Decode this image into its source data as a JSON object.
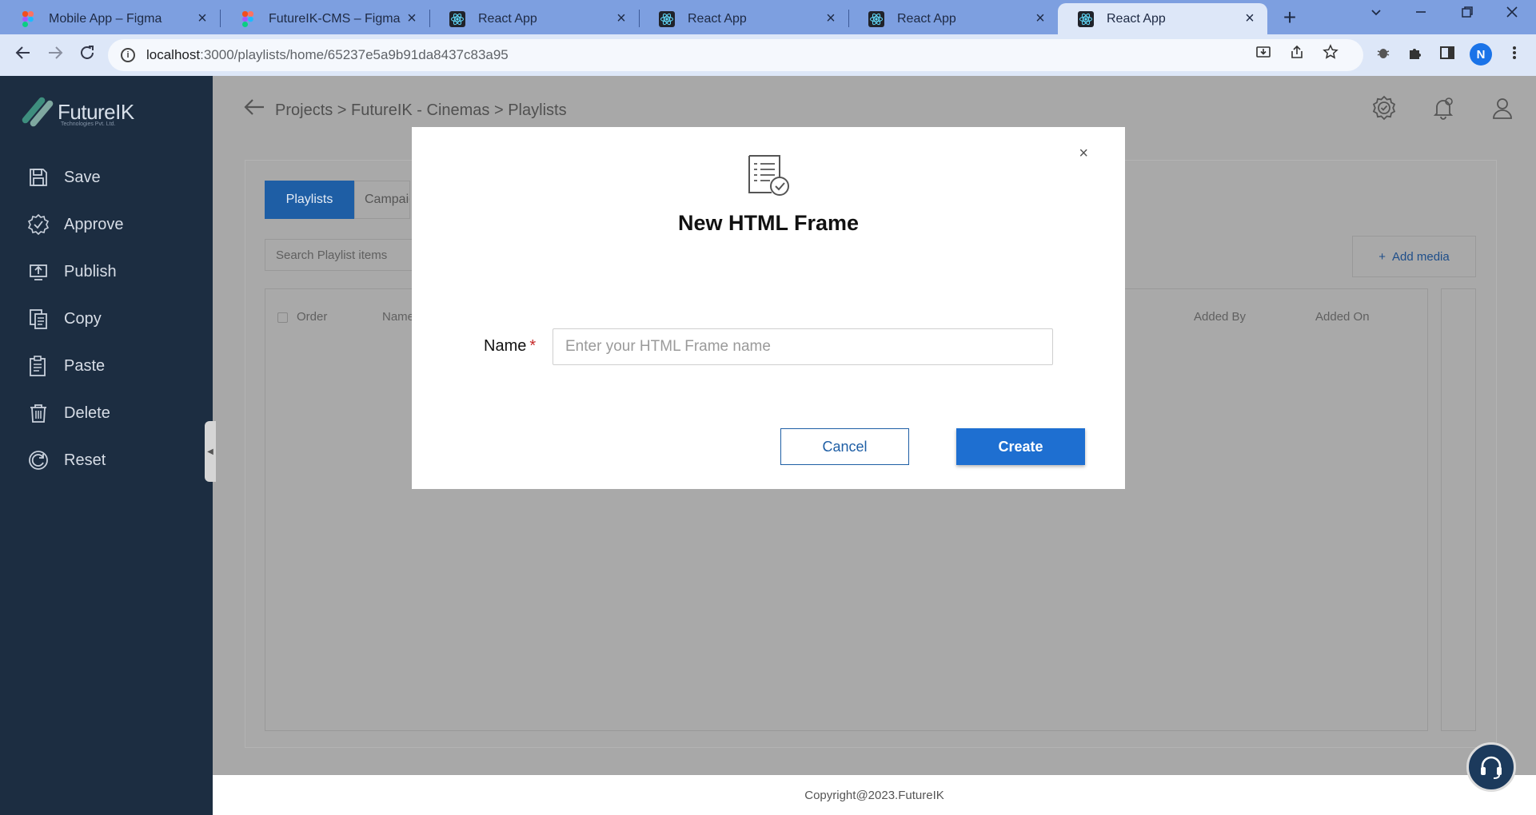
{
  "browser": {
    "tabs": [
      {
        "title": "Mobile App – Figma",
        "icon": "figma-icon"
      },
      {
        "title": "FutureIK-CMS – Figma",
        "icon": "figma-icon"
      },
      {
        "title": "React App",
        "icon": "react-icon"
      },
      {
        "title": "React App",
        "icon": "react-icon"
      },
      {
        "title": "React App",
        "icon": "react-icon"
      },
      {
        "title": "React App",
        "icon": "react-icon"
      }
    ],
    "close_glyph": "×",
    "new_tab_glyph": "+",
    "url_host": "localhost",
    "url_path": ":3000/playlists/home/65237e5a9b91da8437c83a95",
    "profile_initial": "N"
  },
  "sidebar": {
    "logo_text": "FutureIK",
    "logo_sub": "Technologies Pvt. Ltd.",
    "items": [
      {
        "label": "Save",
        "icon": "save-icon"
      },
      {
        "label": "Approve",
        "icon": "approve-icon"
      },
      {
        "label": "Publish",
        "icon": "publish-icon"
      },
      {
        "label": "Copy",
        "icon": "copy-icon"
      },
      {
        "label": "Paste",
        "icon": "paste-icon"
      },
      {
        "label": "Delete",
        "icon": "delete-icon"
      },
      {
        "label": "Reset",
        "icon": "reset-icon"
      }
    ]
  },
  "header": {
    "breadcrumb": "Projects > FutureIK - Cinemas > Playlists"
  },
  "main": {
    "tabs": [
      {
        "label": "Playlists"
      },
      {
        "label": "Campaigns"
      }
    ],
    "search_placeholder": "Search Playlist items",
    "add_media_label": "Add media",
    "columns": [
      "Order",
      "Name",
      "Added By",
      "Added On"
    ]
  },
  "footer": {
    "text": "Copyright@2023.FutureIK"
  },
  "modal": {
    "title": "New HTML Frame",
    "name_label": "Name",
    "required_mark": "*",
    "name_placeholder": "Enter your HTML Frame name",
    "name_value": "",
    "cancel_label": "Cancel",
    "create_label": "Create",
    "close_glyph": "×"
  },
  "colors": {
    "sidebar_bg": "#1c2d41",
    "primary": "#1e6fd1",
    "overlay": "#a8a8a8",
    "tab_strip": "#7d9fe0"
  }
}
